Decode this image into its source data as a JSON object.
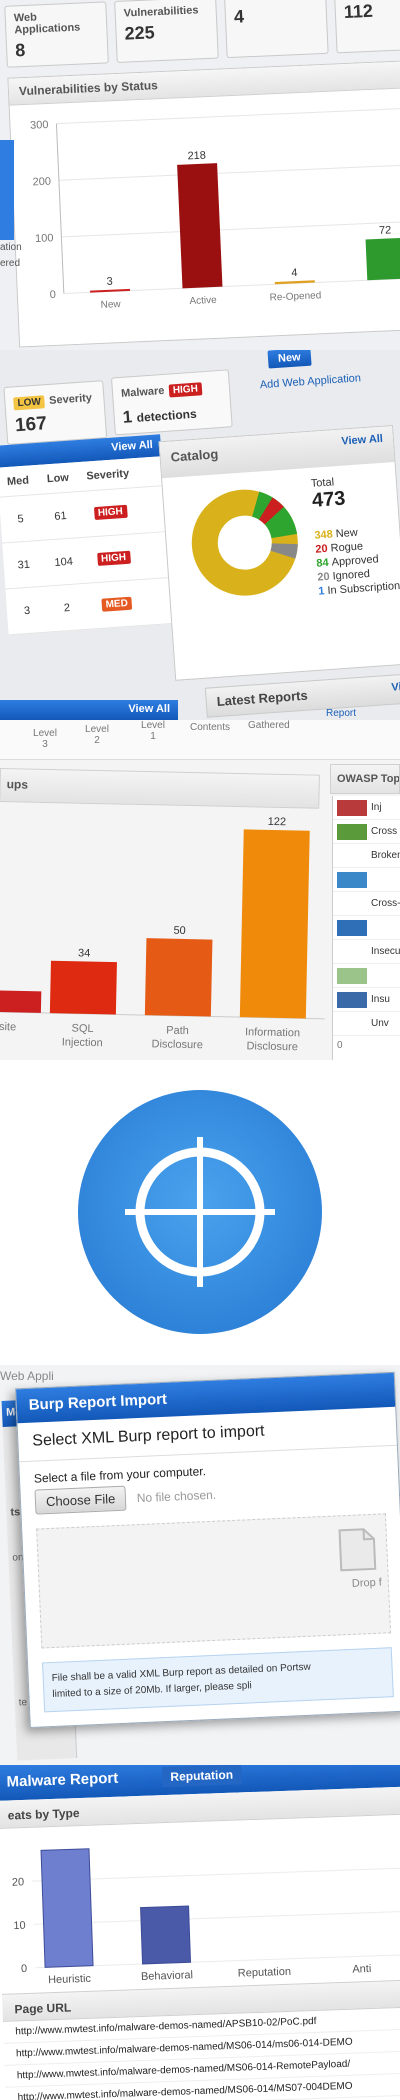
{
  "band1": {
    "stats": [
      {
        "label": "Web Applications",
        "value": "8"
      },
      {
        "label": "Vulnerabilities",
        "value": "225"
      },
      {
        "label": "",
        "value": "4"
      },
      {
        "label": "",
        "value": "112"
      }
    ],
    "panel_title": "Vulnerabilities by Status",
    "side_labels": [
      "ation",
      "ered"
    ]
  },
  "band2": {
    "low_badge": "LOW",
    "severity_label": "Severity",
    "severity_value": "167",
    "malware_label": "Malware",
    "malware_badge": "HIGH",
    "malware_value": "1",
    "malware_text": "detections",
    "new_button": "New",
    "add_web_app": "Add Web Application",
    "view_all": "View All",
    "table_headers": [
      "Med",
      "Low",
      "Severity"
    ],
    "table_rows": [
      {
        "med": "5",
        "low": "61",
        "severity": "HIGH"
      },
      {
        "med": "31",
        "low": "104",
        "severity": "HIGH"
      },
      {
        "med": "3",
        "low": "2",
        "severity": "MED"
      }
    ],
    "catalog_title": "Catalog",
    "catalog_view_all": "View All",
    "total_label": "Total",
    "total_value": "473",
    "legend": [
      {
        "num": "348",
        "label": "New",
        "color": "#d9b21b"
      },
      {
        "num": "20",
        "label": "Rogue",
        "color": "#cc1f1f"
      },
      {
        "num": "84",
        "label": "Approved",
        "color": "#2ea52e"
      },
      {
        "num": "20",
        "label": "Ignored",
        "color": "#888888"
      },
      {
        "num": "1",
        "label": "In Subscription",
        "color": "#2f7de1"
      }
    ],
    "latest_reports": "Latest Reports",
    "latest_view": "View",
    "report_link": "Report",
    "bottom_view_all": "View All"
  },
  "band3": {
    "top_labels": [
      "Level 3",
      "Level 2",
      "Level 1",
      "Contents",
      "Gathered"
    ],
    "groups_title": "ups",
    "owasp_title": "OWASP Top",
    "owasp_items": [
      {
        "label": "Inj",
        "color": "#b83a3a"
      },
      {
        "label": "Cross",
        "color": "#5a9a3a"
      },
      {
        "label": "Broken A",
        "color": ""
      },
      {
        "label": "",
        "color": "#3a88c8"
      },
      {
        "label": "Cross-S",
        "color": ""
      },
      {
        "label": "",
        "color": "#2f6fb8"
      },
      {
        "label": "Insecu",
        "color": ""
      },
      {
        "label": "",
        "color": "#9ac48a"
      },
      {
        "label": "Insu",
        "color": "#3a6aa8"
      },
      {
        "label": "Unv",
        "color": ""
      }
    ],
    "owasp_zero": "0"
  },
  "band5": {
    "bg_title": "Web Appli",
    "dialog_title": "Burp Report Import",
    "subtitle": "Select XML Burp report to import",
    "file_prompt": "Select a file from your computer.",
    "choose_file": "Choose File",
    "no_file": "No file chosen.",
    "drop_text": "Drop f",
    "info_line1": "File shall be a valid XML Burp report as detailed on Portsw",
    "info_line2": "limited to a size of 20Mb. If larger, please spli",
    "sidebar_labels": [
      "Me",
      "ts",
      "on",
      "te"
    ]
  },
  "band6": {
    "title": "Malware Report",
    "tab_label": "Reputation",
    "threats_title": "eats by Type",
    "page_url_header": "Page URL",
    "urls": [
      "http://www.mwtest.info/malware-demos-named/APSB10-02/PoC.pdf",
      "http://www.mwtest.info/malware-demos-named/MS06-014/ms06-014-DEMO",
      "http://www.mwtest.info/malware-demos-named/MS06-014-RemotePayload/",
      "http://www.mwtest.info/malware-demos-named/MS06-014/MS07-004DEMO"
    ]
  },
  "chart_data": [
    {
      "type": "bar",
      "title": "Vulnerabilities by Status",
      "categories": [
        "New",
        "Active",
        "Re-Opened",
        ""
      ],
      "values": [
        3,
        218,
        4,
        72
      ],
      "colors": [
        "#cc1f1f",
        "#9a0f0f",
        "#e0a020",
        "#2e9a2e"
      ],
      "yticks": [
        0,
        100,
        200,
        300
      ],
      "ylim": [
        0,
        300
      ]
    },
    {
      "type": "bar",
      "title": "",
      "categories": [
        "site",
        "SQL Injection",
        "Path Disclosure",
        "Information Disclosure"
      ],
      "values": [
        14,
        34,
        50,
        122
      ],
      "colors": [
        "#cc1f1f",
        "#dd2a10",
        "#e55a14",
        "#f08a0a"
      ],
      "ylim": [
        0,
        130
      ]
    },
    {
      "type": "bar",
      "title": "eats by Type",
      "categories": [
        "Heuristic",
        "Behavioral",
        "Reputation",
        "Anti"
      ],
      "values": [
        27,
        13,
        0,
        0
      ],
      "colors": [
        "#6f7fcf",
        "#4a5aa8",
        "#6f7fcf",
        "#6f7fcf"
      ],
      "yticks": [
        0,
        10,
        20
      ],
      "ylim": [
        0,
        30
      ]
    }
  ]
}
